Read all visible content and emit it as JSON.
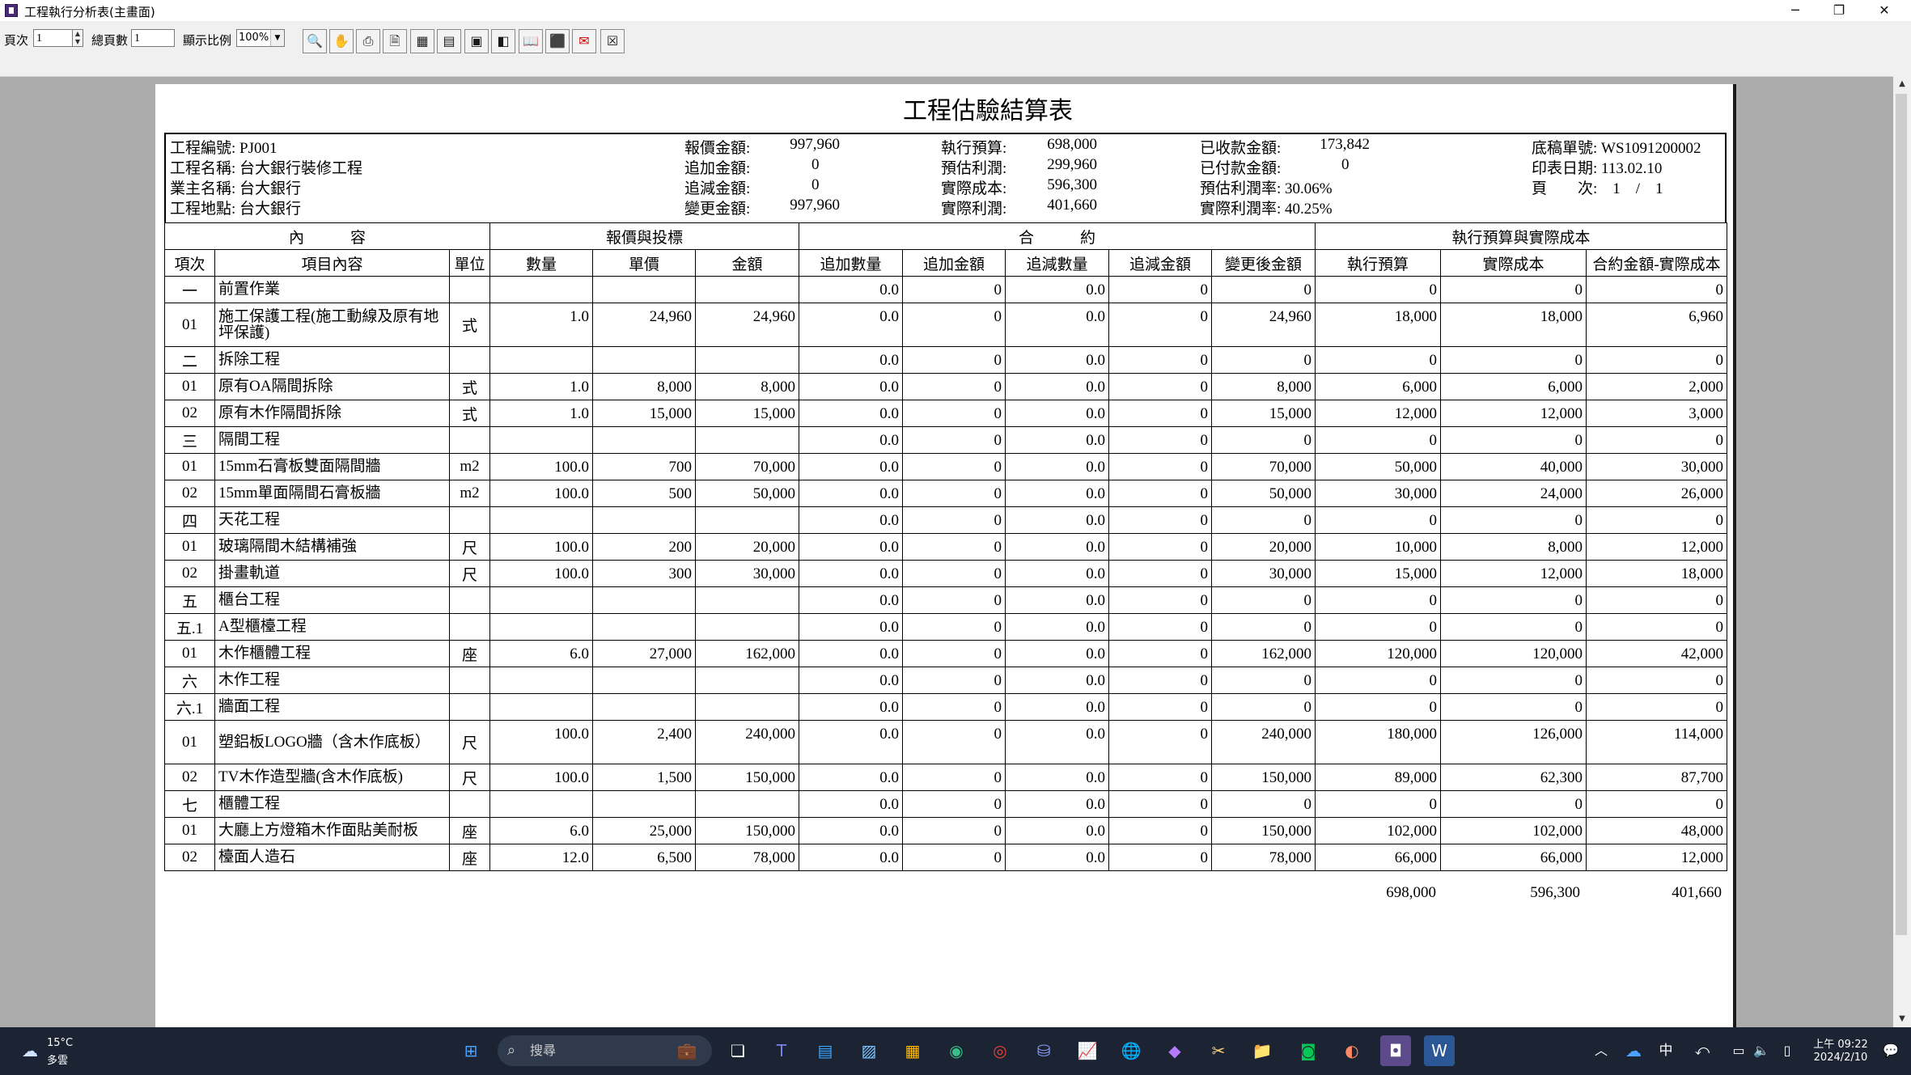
{
  "window": {
    "title": "工程執行分析表(主畫面)",
    "buttons": {
      "minimize": "─",
      "maximize": "❐",
      "close": "✕"
    }
  },
  "toolbar": {
    "page_label": "頁次",
    "page_value": "1",
    "total_label": "總頁數",
    "total_value": "1",
    "zoom_label": "顯示比例",
    "zoom_value": "100%",
    "tools": [
      "search-icon",
      "hand-icon",
      "print-icon",
      "document-icon",
      "export-excel-icon",
      "export-word-icon",
      "export-image-icon",
      "export-html-icon",
      "book-icon",
      "pdf-icon",
      "mail-icon",
      "close-icon"
    ]
  },
  "report": {
    "title": "工程估驗結算表",
    "header": {
      "col1": [
        "工程編號: PJ001",
        "工程名稱: 台大銀行裝修工程",
        "業主名稱: 台大銀行",
        "工程地點: 台大銀行"
      ],
      "col2_labels": [
        "報價金額:",
        "追加金額:",
        "追減金額:",
        "變更金額:"
      ],
      "col2_values": [
        "997,960",
        "0",
        "0",
        "997,960"
      ],
      "col3_labels": [
        "執行預算:",
        "預估利潤:",
        "實際成本:",
        "實際利潤:"
      ],
      "col3_values": [
        "698,000",
        "299,960",
        "596,300",
        "401,660"
      ],
      "col4_labels": [
        "已收款金額:",
        "已付款金額:",
        "預估利潤率: 30.06%",
        "實際利潤率: 40.25%"
      ],
      "col4_values": [
        "173,842",
        "0",
        "",
        ""
      ],
      "col5": [
        "底稿單號: WS1091200002",
        "印表日期: 113.02.10",
        "頁　　次:　1　/　1"
      ]
    },
    "group_headers": [
      "內　　　容",
      "報價與投標",
      "合　　　約",
      "執行預算與實際成本"
    ],
    "columns": [
      "項次",
      "項目內容",
      "單位",
      "數量",
      "單價",
      "金額",
      "追加數量",
      "追加金額",
      "追減數量",
      "追減金額",
      "變更後金額",
      "執行預算",
      "實際成本",
      "合約金額-實際成本"
    ],
    "rows": [
      [
        "一",
        "前置作業",
        "",
        "",
        "",
        "",
        "0.0",
        "0",
        "0.0",
        "0",
        "0",
        "0",
        "0",
        "0"
      ],
      [
        "01",
        "施工保護工程(施工動線及原有地坪保護)",
        "式",
        "1.0",
        "24,960",
        "24,960",
        "0.0",
        "0",
        "0.0",
        "0",
        "24,960",
        "18,000",
        "18,000",
        "6,960"
      ],
      [
        "二",
        "拆除工程",
        "",
        "",
        "",
        "",
        "0.0",
        "0",
        "0.0",
        "0",
        "0",
        "0",
        "0",
        "0"
      ],
      [
        "01",
        "原有OA隔間拆除",
        "式",
        "1.0",
        "8,000",
        "8,000",
        "0.0",
        "0",
        "0.0",
        "0",
        "8,000",
        "6,000",
        "6,000",
        "2,000"
      ],
      [
        "02",
        "原有木作隔間拆除",
        "式",
        "1.0",
        "15,000",
        "15,000",
        "0.0",
        "0",
        "0.0",
        "0",
        "15,000",
        "12,000",
        "12,000",
        "3,000"
      ],
      [
        "三",
        "隔間工程",
        "",
        "",
        "",
        "",
        "0.0",
        "0",
        "0.0",
        "0",
        "0",
        "0",
        "0",
        "0"
      ],
      [
        "01",
        "15mm石膏板雙面隔間牆",
        "m2",
        "100.0",
        "700",
        "70,000",
        "0.0",
        "0",
        "0.0",
        "0",
        "70,000",
        "50,000",
        "40,000",
        "30,000"
      ],
      [
        "02",
        "15mm單面隔間石膏板牆",
        "m2",
        "100.0",
        "500",
        "50,000",
        "0.0",
        "0",
        "0.0",
        "0",
        "50,000",
        "30,000",
        "24,000",
        "26,000"
      ],
      [
        "四",
        "天花工程",
        "",
        "",
        "",
        "",
        "0.0",
        "0",
        "0.0",
        "0",
        "0",
        "0",
        "0",
        "0"
      ],
      [
        "01",
        "玻璃隔間木結構補強",
        "尺",
        "100.0",
        "200",
        "20,000",
        "0.0",
        "0",
        "0.0",
        "0",
        "20,000",
        "10,000",
        "8,000",
        "12,000"
      ],
      [
        "02",
        "掛畫軌道",
        "尺",
        "100.0",
        "300",
        "30,000",
        "0.0",
        "0",
        "0.0",
        "0",
        "30,000",
        "15,000",
        "12,000",
        "18,000"
      ],
      [
        "五",
        "櫃台工程",
        "",
        "",
        "",
        "",
        "0.0",
        "0",
        "0.0",
        "0",
        "0",
        "0",
        "0",
        "0"
      ],
      [
        "五.1",
        "A型櫃檯工程",
        "",
        "",
        "",
        "",
        "0.0",
        "0",
        "0.0",
        "0",
        "0",
        "0",
        "0",
        "0"
      ],
      [
        "01",
        "木作櫃體工程",
        "座",
        "6.0",
        "27,000",
        "162,000",
        "0.0",
        "0",
        "0.0",
        "0",
        "162,000",
        "120,000",
        "120,000",
        "42,000"
      ],
      [
        "六",
        "木作工程",
        "",
        "",
        "",
        "",
        "0.0",
        "0",
        "0.0",
        "0",
        "0",
        "0",
        "0",
        "0"
      ],
      [
        "六.1",
        "牆面工程",
        "",
        "",
        "",
        "",
        "0.0",
        "0",
        "0.0",
        "0",
        "0",
        "0",
        "0",
        "0"
      ],
      [
        "01",
        "塑鋁板LOGO牆（含木作底板）",
        "尺",
        "100.0",
        "2,400",
        "240,000",
        "0.0",
        "0",
        "0.0",
        "0",
        "240,000",
        "180,000",
        "126,000",
        "114,000"
      ],
      [
        "02",
        "TV木作造型牆(含木作底板)",
        "尺",
        "100.0",
        "1,500",
        "150,000",
        "0.0",
        "0",
        "0.0",
        "0",
        "150,000",
        "89,000",
        "62,300",
        "87,700"
      ],
      [
        "七",
        "櫃體工程",
        "",
        "",
        "",
        "",
        "0.0",
        "0",
        "0.0",
        "0",
        "0",
        "0",
        "0",
        "0"
      ],
      [
        "01",
        "大廳上方燈箱木作面貼美耐板",
        "座",
        "6.0",
        "25,000",
        "150,000",
        "0.0",
        "0",
        "0.0",
        "0",
        "150,000",
        "102,000",
        "102,000",
        "48,000"
      ],
      [
        "02",
        "檯面人造石",
        "座",
        "12.0",
        "6,500",
        "78,000",
        "0.0",
        "0",
        "0.0",
        "0",
        "78,000",
        "66,000",
        "66,000",
        "12,000"
      ]
    ],
    "totals": [
      "698,000",
      "596,300",
      "401,660"
    ]
  },
  "taskbar": {
    "weather_temp": "15°C",
    "weather_desc": "多雲",
    "search_placeholder": "搜尋",
    "ime": "中",
    "time": "上午 09:22",
    "date": "2024/2/10"
  }
}
